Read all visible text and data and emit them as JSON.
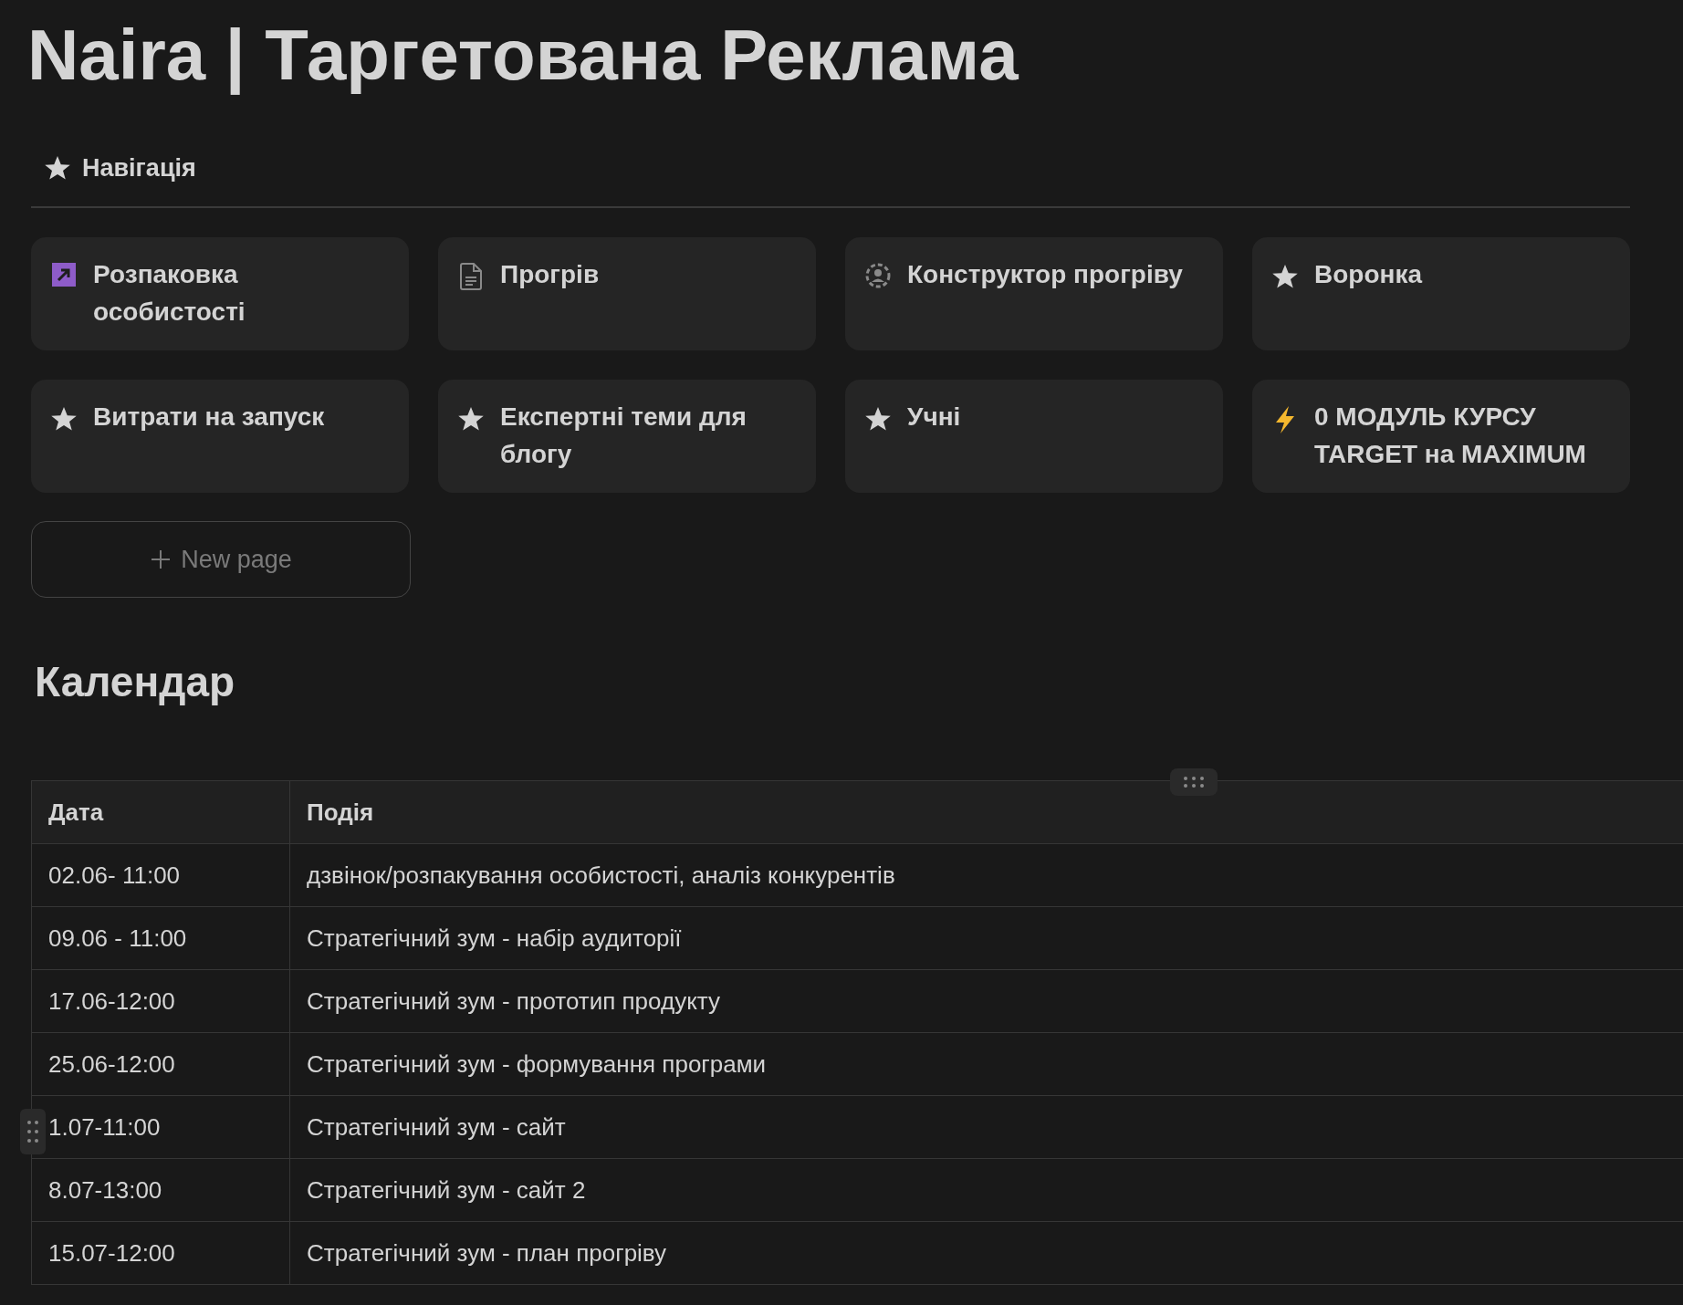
{
  "page_title": "Naira | Таргетована Реклама",
  "navigation": {
    "label": "Навігація"
  },
  "cards": [
    {
      "title": "Розпаковка особистості",
      "kind": "shortcut"
    },
    {
      "title": "Прогрів",
      "kind": "document"
    },
    {
      "title": "Конструктор прогріву",
      "kind": "constructor"
    },
    {
      "title": "Воронка",
      "kind": "starred"
    },
    {
      "title": "Витрати на запуск",
      "kind": "starred"
    },
    {
      "title": "Експертні теми для блогу",
      "kind": "starred"
    },
    {
      "title": "Учні",
      "kind": "starred"
    },
    {
      "title": "0 МОДУЛЬ КУРСУ TARGET на MAXIMUM",
      "kind": "module"
    }
  ],
  "new_page_button": {
    "label": "New page"
  },
  "calendar": {
    "heading": "Календар",
    "columns": [
      "Дата",
      "Подія"
    ],
    "rows": [
      [
        "02.06- 11:00",
        "дзвінок/розпакування особистості, аналіз конкурентів"
      ],
      [
        "09.06 - 11:00",
        "Стратегічний зум - набір аудиторії"
      ],
      [
        "17.06-12:00",
        "Стратегічний зум - прототип продукту"
      ],
      [
        "25.06-12:00",
        "Стратегічний зум - формування програми"
      ],
      [
        "1.07-11:00",
        "Стратегічний зум - сайт"
      ],
      [
        "8.07-13:00",
        "Стратегічний зум - сайт 2"
      ],
      [
        "15.07-12:00",
        "Стратегічний зум - план прогріву"
      ]
    ]
  }
}
